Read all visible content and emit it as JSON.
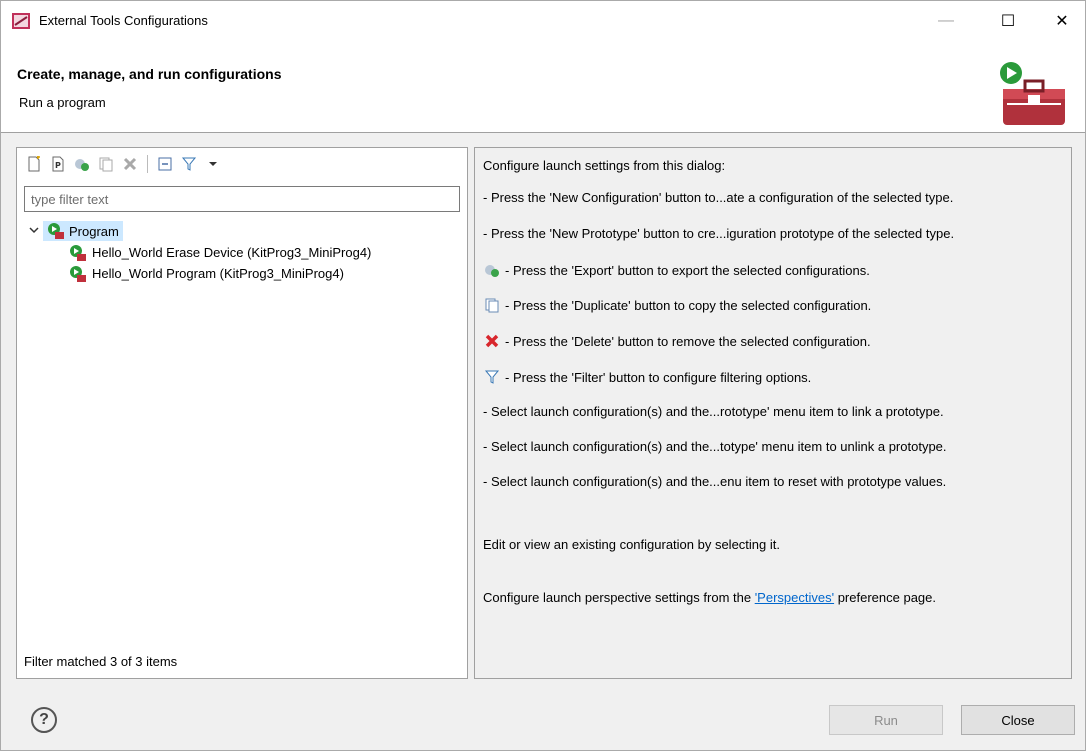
{
  "window": {
    "title": "External Tools Configurations",
    "minimize": "—",
    "maximize": "☐",
    "close": "✕"
  },
  "header": {
    "title": "Create, manage, and run configurations",
    "subtitle": "Run a program"
  },
  "left": {
    "filter_placeholder": "type filter text",
    "filter_value": "",
    "tree": {
      "root": "Program",
      "children": [
        "Hello_World Erase Device (KitProg3_MiniProg4)",
        "Hello_World Program (KitProg3_MiniProg4)"
      ]
    },
    "status": "Filter matched 3 of 3 items"
  },
  "right": {
    "intro": "Configure launch settings from this dialog:",
    "lines": [
      "- Press the 'New Configuration' button to...ate a configuration of the selected type.",
      "- Press the 'New Prototype' button to cre...iguration prototype of the selected type.",
      "- Press the 'Export' button to export the selected configurations.",
      "- Press the 'Duplicate' button to copy the selected configuration.",
      "- Press the 'Delete' button to remove the selected configuration.",
      "- Press the 'Filter' button to configure filtering options.",
      "- Select launch configuration(s) and the...rototype' menu item to link a prototype.",
      "- Select launch configuration(s) and the...totype' menu item to unlink a prototype.",
      "- Select launch configuration(s) and the...enu item to reset with prototype values."
    ],
    "edit_line": "Edit or view an existing configuration by selecting it.",
    "perspective_prefix": "Configure launch perspective settings from the ",
    "perspective_link": "'Perspectives'",
    "perspective_suffix": " preference page."
  },
  "footer": {
    "help": "?",
    "run": "Run",
    "close": "Close"
  }
}
